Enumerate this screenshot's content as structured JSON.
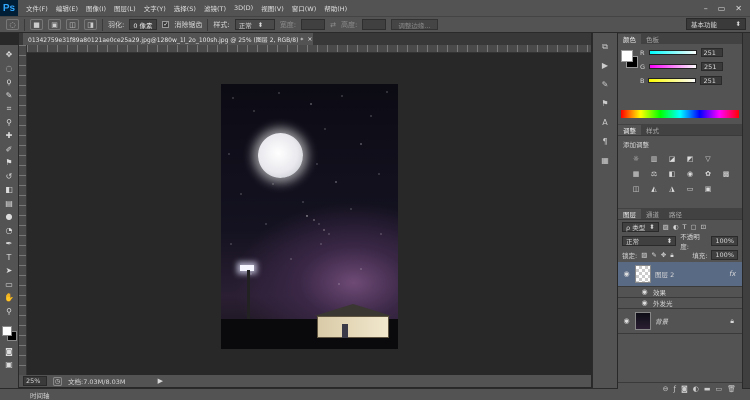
{
  "app": {
    "logo": "Ps"
  },
  "menubar": {
    "items": [
      "文件(F)",
      "编辑(E)",
      "图像(I)",
      "图层(L)",
      "文字(Y)",
      "选择(S)",
      "滤镜(T)",
      "3D(D)",
      "视图(V)",
      "窗口(W)",
      "帮助(H)"
    ],
    "minimize": "–",
    "restore": "▭",
    "close": "✕"
  },
  "options": {
    "feather_label": "羽化:",
    "feather_value": "0 像素",
    "antialias_label": "消除锯齿",
    "antialias_checked": "✓",
    "style_label": "样式:",
    "style_value": "正常",
    "width_label": "宽度:",
    "height_label": "高度:",
    "refine_edge": "调整边缘...",
    "workspace": "基本功能"
  },
  "document": {
    "tab_title": "01342759e31f89a80121ae0ce25a29.jpg@1280w_1l_2o_100sh.jpg @ 25% (图层 2, RGB/8) *",
    "tab_close": "×"
  },
  "status": {
    "zoom": "25%",
    "doc_info": "文档:7.03M/8.03M",
    "arrow": "▶"
  },
  "timeline": {
    "label": "时间轴"
  },
  "color_panel": {
    "tabs": [
      "颜色",
      "色板"
    ],
    "r_label": "R",
    "g_label": "G",
    "b_label": "B",
    "r_value": "251",
    "g_value": "251",
    "b_value": "251"
  },
  "adjust_panel": {
    "tabs": [
      "调整",
      "样式"
    ],
    "title": "添加调整"
  },
  "layers_panel": {
    "tabs": [
      "图层",
      "通道",
      "路径"
    ],
    "filter_label": "ρ 类型",
    "blend_mode": "正常",
    "opacity_label": "不透明度:",
    "opacity_value": "100%",
    "lock_label": "锁定:",
    "fill_label": "填充:",
    "fill_value": "100%",
    "layers": [
      {
        "name": "图层 2",
        "fx": "fx"
      },
      {
        "name": "背景"
      }
    ],
    "effects_label": "效果",
    "outer_glow_label": "外发光"
  },
  "colors": {
    "ui_bg": "#535353",
    "canvas_bg": "#282828",
    "selected_layer": "#596a85"
  }
}
